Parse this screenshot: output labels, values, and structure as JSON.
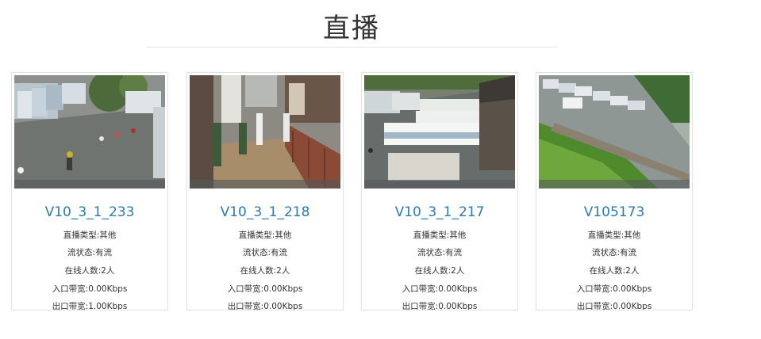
{
  "page": {
    "title": "直播"
  },
  "cards": [
    {
      "name": "V10_3_1_233",
      "type": "直播类型:其他",
      "stream_status": "流状态:有流",
      "online": "在线人数:2人",
      "in_bw": "入口带宽:0.00Kbps",
      "out_bw": "出口带宽:1.00Kbps"
    },
    {
      "name": "V10_3_1_218",
      "type": "直播类型:其他",
      "stream_status": "流状态:有流",
      "online": "在线人数:2人",
      "in_bw": "入口带宽:0.00Kbps",
      "out_bw": "出口带宽:0.00Kbps"
    },
    {
      "name": "V10_3_1_217",
      "type": "直播类型:其他",
      "stream_status": "流状态:有流",
      "online": "在线人数:2人",
      "in_bw": "入口带宽:0.00Kbps",
      "out_bw": "出口带宽:0.00Kbps"
    },
    {
      "name": "V105173",
      "type": "直播类型:其他",
      "stream_status": "流状态:有流",
      "online": "在线人数:2人",
      "in_bw": "入口带宽:0.00Kbps",
      "out_bw": "出口带宽:0.00Kbps"
    }
  ]
}
